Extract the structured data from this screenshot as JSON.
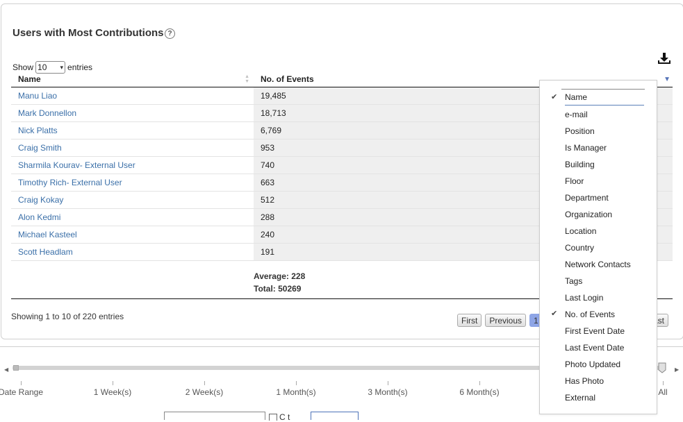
{
  "panel": {
    "title": "Users with Most Contributions",
    "help_glyph": "?"
  },
  "length_control": {
    "show_label": "Show",
    "value": "10",
    "entries_label": "entries"
  },
  "table": {
    "columns": [
      "Name",
      "No. of Events"
    ],
    "rows": [
      {
        "name": "Manu Liao",
        "events": "19,485"
      },
      {
        "name": "Mark Donnellon",
        "events": "18,713"
      },
      {
        "name": "Nick Platts",
        "events": "6,769"
      },
      {
        "name": "Craig Smith",
        "events": "953"
      },
      {
        "name": "Sharmila Kourav- External User",
        "events": "740"
      },
      {
        "name": "Timothy Rich- External User",
        "events": "663"
      },
      {
        "name": "Craig Kokay",
        "events": "512"
      },
      {
        "name": "Alon Kedmi",
        "events": "288"
      },
      {
        "name": "Michael Kasteel",
        "events": "240"
      },
      {
        "name": "Scott Headlam",
        "events": "191"
      }
    ]
  },
  "summary": {
    "average": "Average: 228",
    "total": "Total: 50269"
  },
  "info": "Showing 1 to 10 of 220 entries",
  "pagination": {
    "first": "First",
    "previous": "Previous",
    "current": "1",
    "last": "ast"
  },
  "column_menu": [
    {
      "label": "Name",
      "checked": true
    },
    {
      "label": "e-mail",
      "checked": false
    },
    {
      "label": "Position",
      "checked": false
    },
    {
      "label": "Is Manager",
      "checked": false
    },
    {
      "label": "Building",
      "checked": false
    },
    {
      "label": "Floor",
      "checked": false
    },
    {
      "label": "Department",
      "checked": false
    },
    {
      "label": "Organization",
      "checked": false
    },
    {
      "label": "Location",
      "checked": false
    },
    {
      "label": "Country",
      "checked": false
    },
    {
      "label": "Network Contacts",
      "checked": false
    },
    {
      "label": "Tags",
      "checked": false
    },
    {
      "label": "Last Login",
      "checked": false
    },
    {
      "label": "No. of Events",
      "checked": true
    },
    {
      "label": "First Event Date",
      "checked": false
    },
    {
      "label": "Last Event Date",
      "checked": false
    },
    {
      "label": "Photo Updated",
      "checked": false
    },
    {
      "label": "Has Photo",
      "checked": false
    },
    {
      "label": "External",
      "checked": false
    }
  ],
  "range_slider": {
    "labels": [
      "Date Range",
      "1 Week(s)",
      "2 Week(s)",
      "1 Month(s)",
      "3 Month(s)",
      "6 Month(s)",
      "All"
    ]
  },
  "bottom_controls": {
    "checkbox_label": "C          t"
  },
  "icons": {
    "download": "download-icon",
    "help": "help-icon",
    "check": "check-icon"
  },
  "colors": {
    "link": "#3a6fa8",
    "current_page": "#8ea5e6",
    "menu_caret": "#5573b8"
  }
}
